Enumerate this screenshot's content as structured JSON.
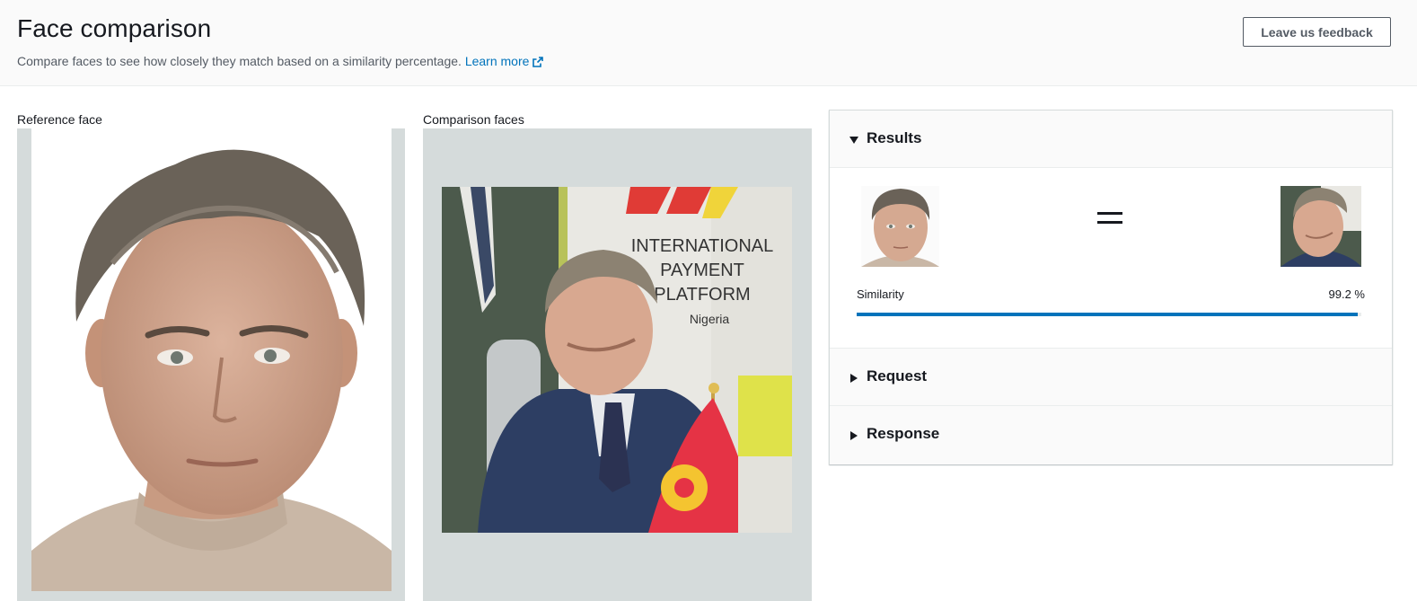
{
  "header": {
    "title": "Face comparison",
    "description": "Compare faces to see how closely they match based on a similarity percentage.",
    "learn_more": "Learn more",
    "feedback_button": "Leave us feedback"
  },
  "reference": {
    "label": "Reference face"
  },
  "comparison": {
    "label": "Comparison faces",
    "sign_lines": [
      "INTERNATIONAL",
      "PAYMENT",
      "PLATFORM",
      "Nigeria"
    ]
  },
  "results_panel": {
    "results_title": "Results",
    "request_title": "Request",
    "response_title": "Response",
    "similarity_label": "Similarity",
    "similarity_value": "99.2 %",
    "similarity_fraction": 0.992
  },
  "colors": {
    "accent": "#0073bb",
    "header_bg": "#fafafa",
    "frame_bg": "#d5dbdb"
  },
  "icons": {
    "external_link": "external-link-icon",
    "caret_expanded": "caret-down-icon",
    "caret_collapsed": "caret-right-icon"
  }
}
